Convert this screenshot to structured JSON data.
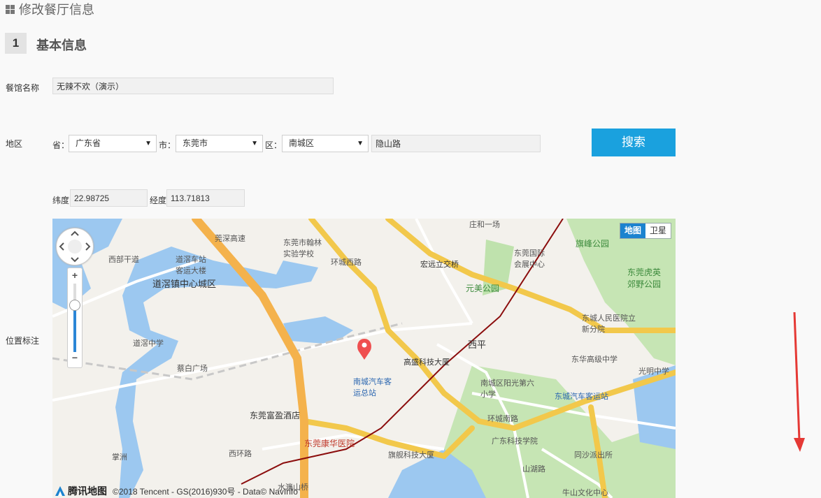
{
  "header": {
    "title": "修改餐厅信息",
    "icon": "grid-icon"
  },
  "section": {
    "number": "1",
    "title": "基本信息"
  },
  "restaurant_name": {
    "label": "餐馆名称",
    "value": "无辣不欢（演示）"
  },
  "region": {
    "label": "地区",
    "province_label": "省：",
    "province_value": "广东省",
    "city_label": "市：",
    "city_value": "东莞市",
    "district_label": "区：",
    "district_value": "南城区",
    "address_value": "隐山路",
    "search_label": "搜索"
  },
  "coords": {
    "lat_label": "纬度",
    "lat_value": "22.98725",
    "lng_label": "经度",
    "lng_value": "113.71813"
  },
  "location": {
    "label": "位置标注"
  },
  "map": {
    "type_map": "地图",
    "type_satellite": "卫星",
    "brand": "腾讯地图",
    "copyright": "©2018 Tencent - GS(2016)930号 - Data© NavInfo",
    "places": [
      "道滘镇中心城区",
      "东莞市翰林实验学校",
      "道滘车站客运大楼",
      "宏远立交桥",
      "东莞国际会展中心",
      "旗峰公园",
      "元美公园",
      "东莞虎英郊野公园",
      "东城人民医院立新分院",
      "道滘中学",
      "高盛科技大厦",
      "南城汽车客运总站",
      "西平",
      "东华高级中学",
      "光明中学",
      "蔡白广场",
      "南城区阳光第六小学",
      "东城汽车客运站",
      "东莞富盈酒店",
      "环城南路",
      "东莞康华医院",
      "广东科技学院",
      "西环路",
      "旗舰科技大厦",
      "同沙派出所",
      "山湖路",
      "掌洲",
      "牛山文化中心",
      "水濂山桥",
      "环城西路",
      "莞深高速",
      "西部干道",
      "庄和一场"
    ]
  },
  "annotation": {
    "arrow_color": "#e53935"
  }
}
